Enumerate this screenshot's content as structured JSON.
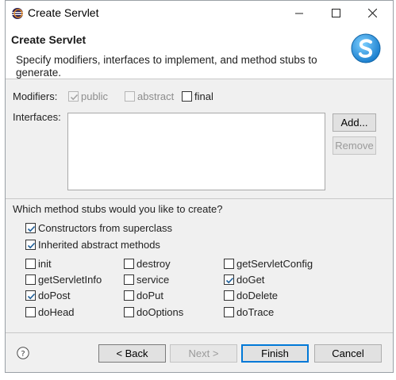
{
  "window": {
    "title": "Create Servlet"
  },
  "header": {
    "title": "Create Servlet",
    "description": "Specify modifiers, interfaces to implement, and method stubs to generate."
  },
  "modifiers": {
    "label": "Modifiers:",
    "public": {
      "label": "public",
      "checked": true,
      "enabled": false
    },
    "abstract": {
      "label": "abstract",
      "checked": false,
      "enabled": false
    },
    "final": {
      "label": "final",
      "checked": false,
      "enabled": true
    }
  },
  "interfaces": {
    "label": "Interfaces:",
    "add_label": "Add...",
    "remove_label": "Remove"
  },
  "stubs": {
    "question": "Which method stubs would you like to create?",
    "constructors": {
      "label": "Constructors from superclass",
      "checked": true
    },
    "inherited": {
      "label": "Inherited abstract methods",
      "checked": true
    },
    "methods": [
      {
        "label": "init",
        "checked": false
      },
      {
        "label": "destroy",
        "checked": false
      },
      {
        "label": "getServletConfig",
        "checked": false
      },
      {
        "label": "getServletInfo",
        "checked": false
      },
      {
        "label": "service",
        "checked": false
      },
      {
        "label": "doGet",
        "checked": true
      },
      {
        "label": "doPost",
        "checked": true
      },
      {
        "label": "doPut",
        "checked": false
      },
      {
        "label": "doDelete",
        "checked": false
      },
      {
        "label": "doHead",
        "checked": false
      },
      {
        "label": "doOptions",
        "checked": false
      },
      {
        "label": "doTrace",
        "checked": false
      }
    ]
  },
  "footer": {
    "back_label": "< Back",
    "next_label": "Next >",
    "finish_label": "Finish",
    "cancel_label": "Cancel"
  },
  "colors": {
    "accent": "#0078d7",
    "checkmark": "#1f5f99",
    "logo": "#2b9be0"
  },
  "icons": [
    "eclipse-icon",
    "minimize-icon",
    "maximize-icon",
    "close-icon",
    "servlet-logo-icon",
    "help-icon",
    "check-icon"
  ]
}
